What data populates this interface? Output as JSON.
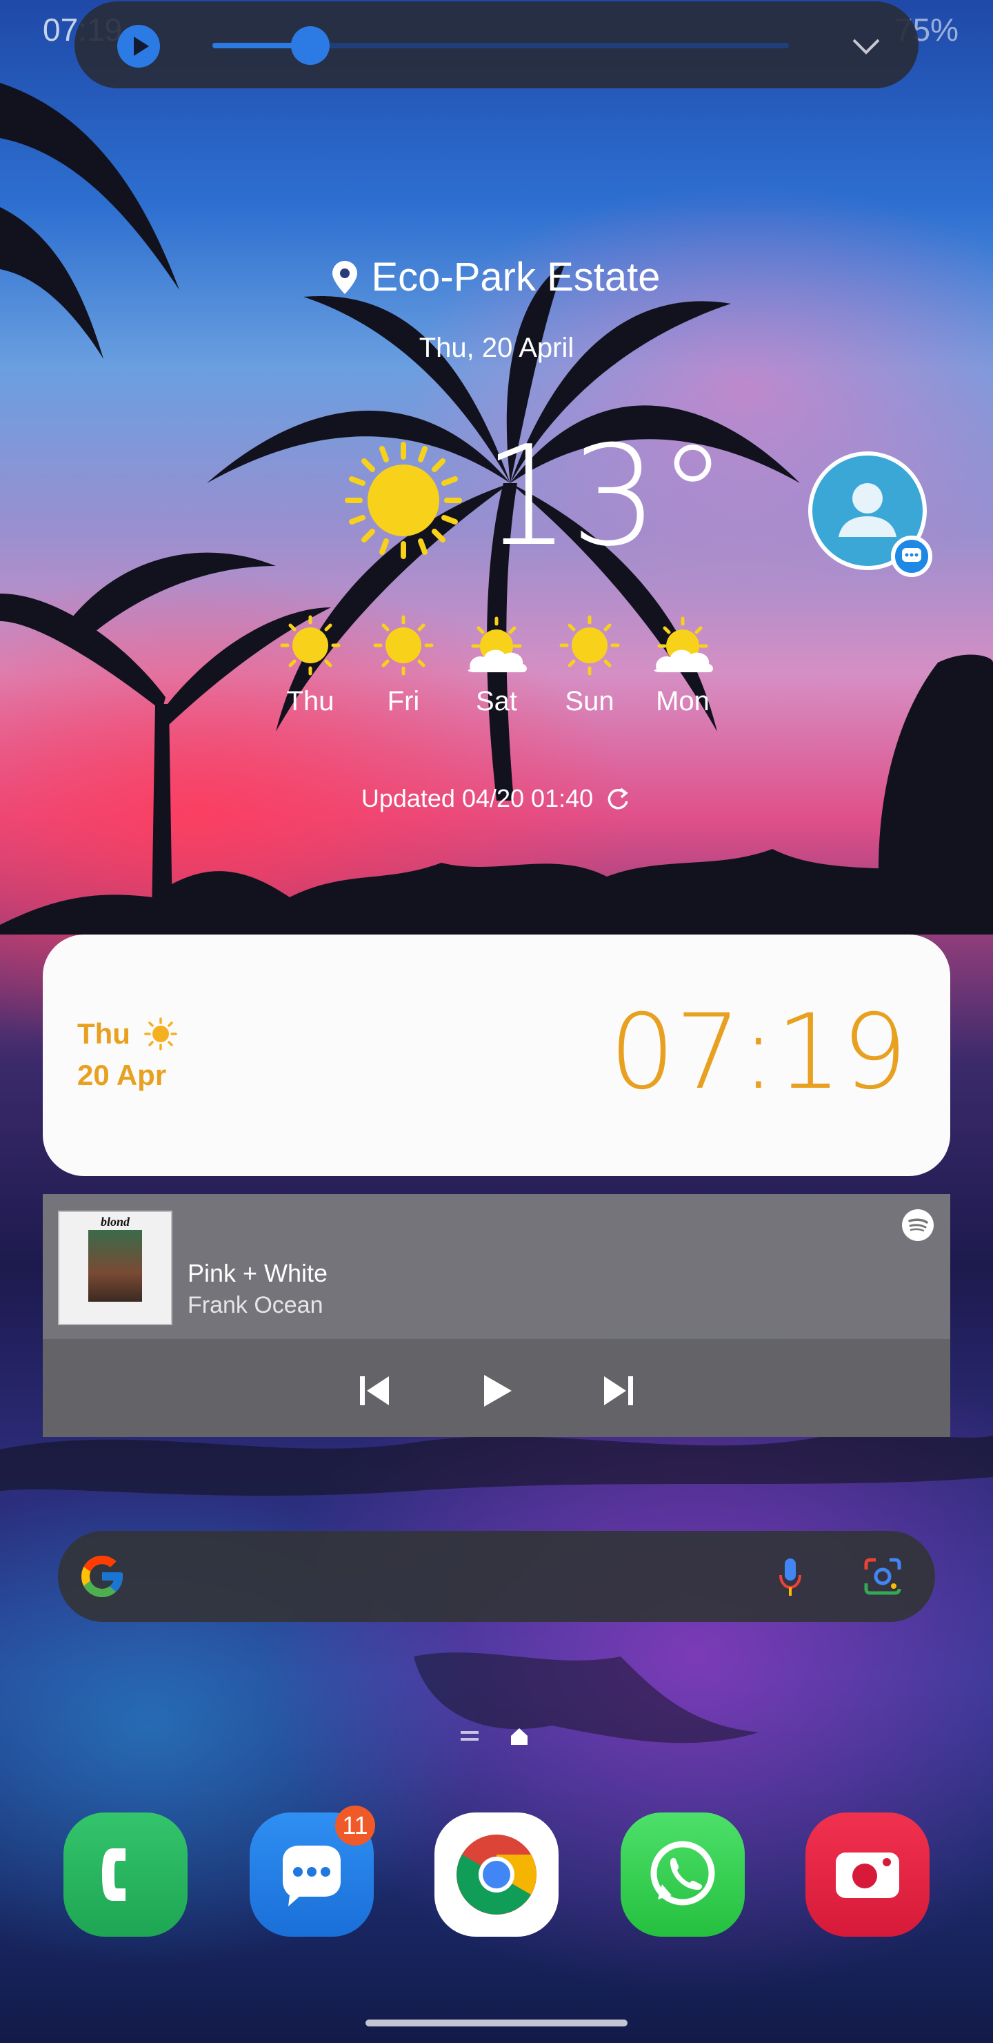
{
  "status_bar": {
    "time": "07:19",
    "battery": "75%"
  },
  "media_overlay": {
    "state": "paused",
    "progress": 0.17
  },
  "weather": {
    "location": "Eco-Park Estate",
    "date": "Thu, 20 April",
    "temperature": "13°",
    "forecast": [
      {
        "day": "Thu",
        "icon": "sun-icon"
      },
      {
        "day": "Fri",
        "icon": "sun-icon"
      },
      {
        "day": "Sat",
        "icon": "partly-cloudy-icon"
      },
      {
        "day": "Sun",
        "icon": "sun-icon"
      },
      {
        "day": "Mon",
        "icon": "partly-cloudy-icon"
      }
    ],
    "updated": "Updated 04/20 01:40"
  },
  "clock_widget": {
    "day": "Thu",
    "date": "20 Apr",
    "time": "07:19",
    "accent": "#e8a020"
  },
  "music": {
    "album_text": "blond",
    "title": "Pink + White",
    "artist": "Frank Ocean",
    "source_icon": "spotify-icon"
  },
  "dock": {
    "messages_badge": "11"
  },
  "colors": {
    "accent_blue": "#2c7be5",
    "clock_orange": "#e8a020"
  }
}
